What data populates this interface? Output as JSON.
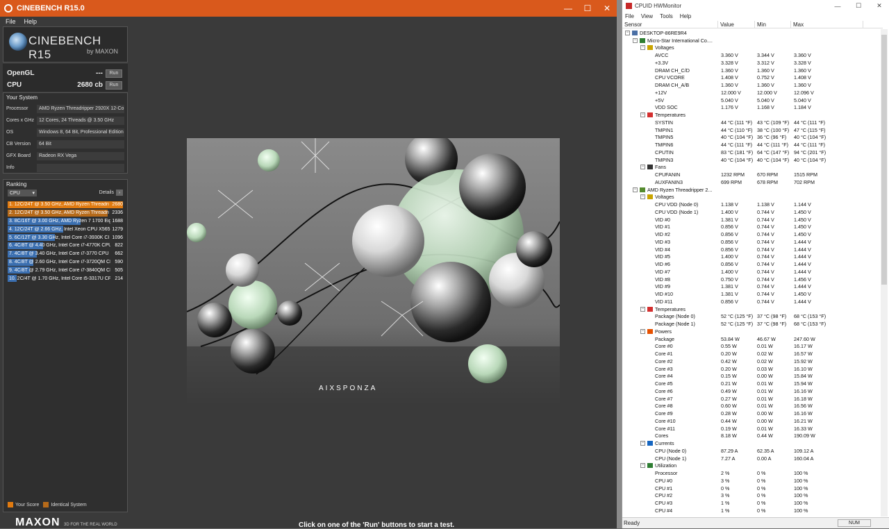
{
  "cinebench": {
    "title": "CINEBENCH R15.0",
    "menu": [
      "File",
      "Help"
    ],
    "logo_title": "CINEBENCH R15",
    "logo_sub": "by MAXON",
    "opengl_label": "OpenGL",
    "opengl_value": "---",
    "cpu_label": "CPU",
    "cpu_value": "2680 cb",
    "run_label": "Run",
    "your_system_title": "Your System",
    "system": [
      {
        "label": "Processor",
        "value": "AMD Ryzen Threadripper 2920X 12-Co"
      },
      {
        "label": "Cores x GHz",
        "value": "12 Cores, 24 Threads @ 3.50 GHz"
      },
      {
        "label": "OS",
        "value": "Windows 8, 64 Bit, Professional Edition"
      },
      {
        "label": "CB Version",
        "value": "64 Bit"
      },
      {
        "label": "GFX Board",
        "value": "Radeon RX Vega"
      },
      {
        "label": "Info",
        "value": ""
      }
    ],
    "ranking_title": "Ranking",
    "ranking_select": "CPU",
    "details_label": "Details",
    "ranking": [
      {
        "text": "1. 12C/24T @ 3.50 GHz, AMD Ryzen Threadri",
        "score": "2680",
        "pct": 1.0,
        "color": "#e07a10"
      },
      {
        "text": "2. 12C/24T @ 3.50 GHz, AMD Ryzen Threadri",
        "score": "2336",
        "pct": 0.87,
        "color": "#b66a1a"
      },
      {
        "text": "3. 8C/16T @ 3.00 GHz, AMD Ryzen 7 1700 Eig",
        "score": "1688",
        "pct": 0.63,
        "color": "#3b6fb0"
      },
      {
        "text": "4. 12C/24T @ 2.66 GHz, Intel Xeon CPU X565",
        "score": "1279",
        "pct": 0.48,
        "color": "#3b6fb0"
      },
      {
        "text": "5. 6C/12T @ 3.30 GHz, Intel Core i7-3930K CI",
        "score": "1096",
        "pct": 0.41,
        "color": "#3b6fb0"
      },
      {
        "text": "6. 4C/8T @ 4.40 GHz, Intel Core i7-4770K CPU",
        "score": "822",
        "pct": 0.31,
        "color": "#3b6fb0"
      },
      {
        "text": "7. 4C/8T @ 3.40 GHz, Intel Core i7-3770 CPU",
        "score": "662",
        "pct": 0.25,
        "color": "#3b6fb0"
      },
      {
        "text": "8. 4C/8T @ 2.60 GHz, Intel Core i7-3720QM CP",
        "score": "590",
        "pct": 0.22,
        "color": "#3b6fb0"
      },
      {
        "text": "9. 4C/8T @ 2.79 GHz, Intel Core i7-3840QM CI",
        "score": "505",
        "pct": 0.19,
        "color": "#3b6fb0"
      },
      {
        "text": "10. 2C/4T @ 1.70 GHz, Intel Core i5-3317U CP",
        "score": "214",
        "pct": 0.08,
        "color": "#3b6fb0"
      }
    ],
    "legend_your": "Your Score",
    "legend_identical": "Identical System",
    "maxon_logo": "MAXON",
    "maxon_tag": "3D FOR THE REAL WORLD",
    "status": "Click on one of the 'Run' buttons to start a test.",
    "render_brand": "AIXSPONZA"
  },
  "hwmonitor": {
    "title": "CPUID HWMonitor",
    "menu": [
      "File",
      "View",
      "Tools",
      "Help"
    ],
    "columns": [
      "Sensor",
      "Value",
      "Min",
      "Max"
    ],
    "rows": [
      {
        "level": 0,
        "type": "node",
        "exp": "⊟",
        "icon": "computer-icon",
        "name": "DESKTOP-86RE9R4"
      },
      {
        "level": 1,
        "type": "node",
        "exp": "⊟",
        "icon": "motherboard-icon",
        "name": "Micro-Star International Co...."
      },
      {
        "level": 2,
        "type": "node",
        "exp": "⊟",
        "icon": "voltage-icon",
        "name": "Voltages"
      },
      {
        "level": 3,
        "name": "AVCC",
        "value": "3.360 V",
        "min": "3.344 V",
        "max": "3.360 V"
      },
      {
        "level": 3,
        "name": "+3.3V",
        "value": "3.328 V",
        "min": "3.312 V",
        "max": "3.328 V"
      },
      {
        "level": 3,
        "name": "DRAM CH_C/D",
        "value": "1.360 V",
        "min": "1.360 V",
        "max": "1.360 V"
      },
      {
        "level": 3,
        "name": "CPU VCORE",
        "value": "1.408 V",
        "min": "0.752 V",
        "max": "1.408 V"
      },
      {
        "level": 3,
        "name": "DRAM CH_A/B",
        "value": "1.360 V",
        "min": "1.360 V",
        "max": "1.360 V"
      },
      {
        "level": 3,
        "name": "+12V",
        "value": "12.000 V",
        "min": "12.000 V",
        "max": "12.096 V"
      },
      {
        "level": 3,
        "name": "+5V",
        "value": "5.040 V",
        "min": "5.040 V",
        "max": "5.040 V"
      },
      {
        "level": 3,
        "name": "VDD SOC",
        "value": "1.176 V",
        "min": "1.168 V",
        "max": "1.184 V"
      },
      {
        "level": 2,
        "type": "node",
        "exp": "⊟",
        "icon": "thermometer-icon",
        "name": "Temperatures"
      },
      {
        "level": 3,
        "name": "SYSTIN",
        "value": "44 °C (111 °F)",
        "min": "43 °C (109 °F)",
        "max": "44 °C (111 °F)"
      },
      {
        "level": 3,
        "name": "TMPIN1",
        "value": "44 °C (110 °F)",
        "min": "38 °C (100 °F)",
        "max": "47 °C (115 °F)"
      },
      {
        "level": 3,
        "name": "TMPIN5",
        "value": "40 °C (104 °F)",
        "min": "36 °C (96 °F)",
        "max": "40 °C (104 °F)"
      },
      {
        "level": 3,
        "name": "TMPIN6",
        "value": "44 °C (111 °F)",
        "min": "44 °C (111 °F)",
        "max": "44 °C (111 °F)"
      },
      {
        "level": 3,
        "name": "CPUTIN",
        "value": "83 °C (181 °F)",
        "min": "64 °C (147 °F)",
        "max": "94 °C (201 °F)"
      },
      {
        "level": 3,
        "name": "TMPIN3",
        "value": "40 °C (104 °F)",
        "min": "40 °C (104 °F)",
        "max": "40 °C (104 °F)"
      },
      {
        "level": 2,
        "type": "node",
        "exp": "⊟",
        "icon": "fan-icon",
        "name": "Fans"
      },
      {
        "level": 3,
        "name": "CPUFANIN",
        "value": "1232 RPM",
        "min": "670 RPM",
        "max": "1515 RPM"
      },
      {
        "level": 3,
        "name": "AUXFANIN3",
        "value": "699 RPM",
        "min": "678 RPM",
        "max": "702 RPM"
      },
      {
        "level": 1,
        "type": "node",
        "exp": "⊟",
        "icon": "cpu-icon",
        "name": "AMD Ryzen Threadripper 2..."
      },
      {
        "level": 2,
        "type": "node",
        "exp": "⊟",
        "icon": "voltage-icon",
        "name": "Voltages"
      },
      {
        "level": 3,
        "name": "CPU VDD (Node 0)",
        "value": "1.138 V",
        "min": "1.138 V",
        "max": "1.144 V"
      },
      {
        "level": 3,
        "name": "CPU VDD (Node 1)",
        "value": "1.400 V",
        "min": "0.744 V",
        "max": "1.450 V"
      },
      {
        "level": 3,
        "name": "VID #0",
        "value": "1.381 V",
        "min": "0.744 V",
        "max": "1.450 V"
      },
      {
        "level": 3,
        "name": "VID #1",
        "value": "0.856 V",
        "min": "0.744 V",
        "max": "1.450 V"
      },
      {
        "level": 3,
        "name": "VID #2",
        "value": "0.856 V",
        "min": "0.744 V",
        "max": "1.450 V"
      },
      {
        "level": 3,
        "name": "VID #3",
        "value": "0.856 V",
        "min": "0.744 V",
        "max": "1.444 V"
      },
      {
        "level": 3,
        "name": "VID #4",
        "value": "0.856 V",
        "min": "0.744 V",
        "max": "1.444 V"
      },
      {
        "level": 3,
        "name": "VID #5",
        "value": "1.400 V",
        "min": "0.744 V",
        "max": "1.444 V"
      },
      {
        "level": 3,
        "name": "VID #6",
        "value": "0.856 V",
        "min": "0.744 V",
        "max": "1.444 V"
      },
      {
        "level": 3,
        "name": "VID #7",
        "value": "1.400 V",
        "min": "0.744 V",
        "max": "1.444 V"
      },
      {
        "level": 3,
        "name": "VID #8",
        "value": "0.750 V",
        "min": "0.744 V",
        "max": "1.456 V"
      },
      {
        "level": 3,
        "name": "VID #9",
        "value": "1.381 V",
        "min": "0.744 V",
        "max": "1.444 V"
      },
      {
        "level": 3,
        "name": "VID #10",
        "value": "1.381 V",
        "min": "0.744 V",
        "max": "1.450 V"
      },
      {
        "level": 3,
        "name": "VID #11",
        "value": "0.856 V",
        "min": "0.744 V",
        "max": "1.444 V"
      },
      {
        "level": 2,
        "type": "node",
        "exp": "⊟",
        "icon": "thermometer-icon",
        "name": "Temperatures"
      },
      {
        "level": 3,
        "name": "Package (Node 0)",
        "value": "52 °C (125 °F)",
        "min": "37 °C (98 °F)",
        "max": "68 °C (153 °F)"
      },
      {
        "level": 3,
        "name": "Package (Node 1)",
        "value": "52 °C (125 °F)",
        "min": "37 °C (98 °F)",
        "max": "68 °C (153 °F)"
      },
      {
        "level": 2,
        "type": "node",
        "exp": "⊟",
        "icon": "power-icon",
        "name": "Powers"
      },
      {
        "level": 3,
        "name": "Package",
        "value": "53.84 W",
        "min": "46.67 W",
        "max": "247.60 W"
      },
      {
        "level": 3,
        "name": "Core #0",
        "value": "0.55 W",
        "min": "0.01 W",
        "max": "16.17 W"
      },
      {
        "level": 3,
        "name": "Core #1",
        "value": "0.20 W",
        "min": "0.02 W",
        "max": "16.57 W"
      },
      {
        "level": 3,
        "name": "Core #2",
        "value": "0.42 W",
        "min": "0.02 W",
        "max": "15.92 W"
      },
      {
        "level": 3,
        "name": "Core #3",
        "value": "0.20 W",
        "min": "0.03 W",
        "max": "16.10 W"
      },
      {
        "level": 3,
        "name": "Core #4",
        "value": "0.15 W",
        "min": "0.00 W",
        "max": "15.84 W"
      },
      {
        "level": 3,
        "name": "Core #5",
        "value": "0.21 W",
        "min": "0.01 W",
        "max": "15.94 W"
      },
      {
        "level": 3,
        "name": "Core #6",
        "value": "0.49 W",
        "min": "0.01 W",
        "max": "16.16 W"
      },
      {
        "level": 3,
        "name": "Core #7",
        "value": "0.27 W",
        "min": "0.01 W",
        "max": "16.18 W"
      },
      {
        "level": 3,
        "name": "Core #8",
        "value": "0.60 W",
        "min": "0.01 W",
        "max": "16.56 W"
      },
      {
        "level": 3,
        "name": "Core #9",
        "value": "0.28 W",
        "min": "0.00 W",
        "max": "16.16 W"
      },
      {
        "level": 3,
        "name": "Core #10",
        "value": "0.44 W",
        "min": "0.00 W",
        "max": "16.21 W"
      },
      {
        "level": 3,
        "name": "Core #11",
        "value": "0.19 W",
        "min": "0.01 W",
        "max": "16.33 W"
      },
      {
        "level": 3,
        "name": "Cores",
        "value": "8.18 W",
        "min": "0.44 W",
        "max": "190.09 W"
      },
      {
        "level": 2,
        "type": "node",
        "exp": "⊟",
        "icon": "current-icon",
        "name": "Currents"
      },
      {
        "level": 3,
        "name": "CPU (Node 0)",
        "value": "87.29 A",
        "min": "62.35 A",
        "max": "109.12 A"
      },
      {
        "level": 3,
        "name": "CPU (Node 1)",
        "value": "7.27 A",
        "min": "0.00 A",
        "max": "160.04 A"
      },
      {
        "level": 2,
        "type": "node",
        "exp": "⊟",
        "icon": "utilization-icon",
        "name": "Utilization"
      },
      {
        "level": 3,
        "name": "Processor",
        "value": "2 %",
        "min": "0 %",
        "max": "100 %"
      },
      {
        "level": 3,
        "name": "CPU #0",
        "value": "3 %",
        "min": "0 %",
        "max": "100 %"
      },
      {
        "level": 3,
        "name": "CPU #1",
        "value": "0 %",
        "min": "0 %",
        "max": "100 %"
      },
      {
        "level": 3,
        "name": "CPU #2",
        "value": "3 %",
        "min": "0 %",
        "max": "100 %"
      },
      {
        "level": 3,
        "name": "CPU #3",
        "value": "1 %",
        "min": "0 %",
        "max": "100 %"
      },
      {
        "level": 3,
        "name": "CPU #4",
        "value": "1 %",
        "min": "0 %",
        "max": "100 %"
      }
    ],
    "status": "Ready",
    "num": "NUM"
  }
}
